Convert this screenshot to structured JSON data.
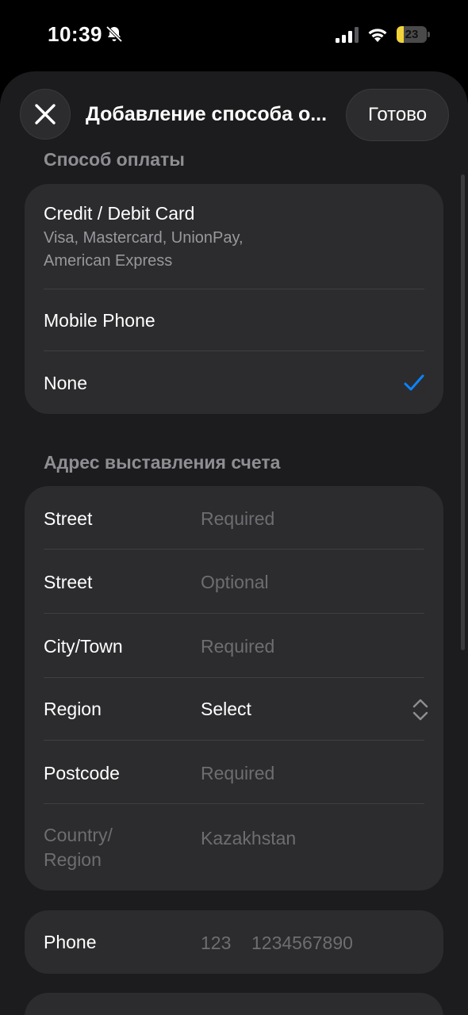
{
  "status_bar": {
    "time": "10:39",
    "battery_level": "23",
    "battery_fraction": 0.23,
    "icons": [
      "bell-slash-icon",
      "cellular-signal-icon",
      "wifi-icon",
      "battery-icon"
    ]
  },
  "header": {
    "title": "Добавление способа о...",
    "done_label": "Готово"
  },
  "payment": {
    "section_title": "Способ оплаты",
    "options": [
      {
        "title": "Credit / Debit Card",
        "subtitle": "Visa, Mastercard, UnionPay, American Express"
      },
      {
        "title": "Mobile Phone"
      },
      {
        "title": "None",
        "selected": true
      }
    ]
  },
  "billing": {
    "section_title": "Адрес выставления счета",
    "fields": {
      "street1": {
        "label": "Street",
        "placeholder": "Required"
      },
      "street2": {
        "label": "Street",
        "placeholder": "Optional"
      },
      "city": {
        "label": "City/Town",
        "placeholder": "Required"
      },
      "region": {
        "label": "Region",
        "value": "Select"
      },
      "postcode": {
        "label": "Postcode",
        "placeholder": "Required"
      },
      "country": {
        "label": "Country/ Region",
        "value": "Kazakhstan"
      }
    }
  },
  "phone": {
    "label": "Phone",
    "code_placeholder": "123",
    "number_placeholder": "1234567890"
  },
  "colors": {
    "accent": "#0a84ff",
    "sheet_bg": "#1c1c1e",
    "group_bg": "#2c2c2e",
    "battery": "#f2d33a"
  }
}
